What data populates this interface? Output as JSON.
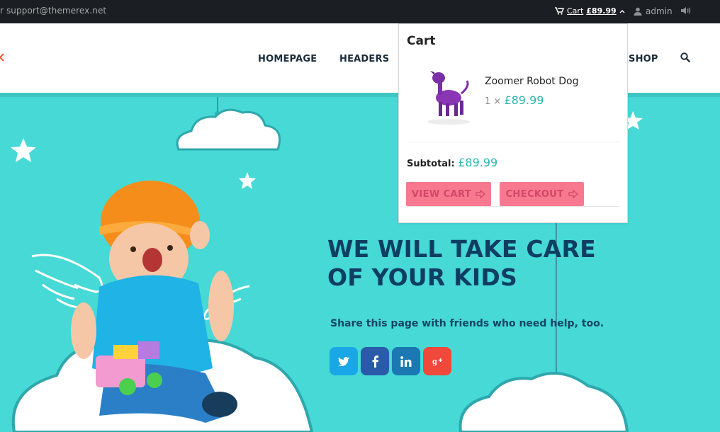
{
  "topbar": {
    "email": "r support@themerex.net",
    "cart_label": "Cart",
    "cart_amount": "£89.99",
    "user": "admin"
  },
  "nav": {
    "items": [
      "HOMEPAGE",
      "HEADERS",
      "SHOP"
    ]
  },
  "cart": {
    "title": "Cart",
    "product_name": "Zoomer Robot Dog",
    "qty": "1 ×",
    "price": "£89.99",
    "subtotal_label": "Subtotal:",
    "subtotal_value": "£89.99",
    "view_cart": "VIEW CART",
    "checkout": "CHECKOUT"
  },
  "hero": {
    "headline_1": "WE WILL TAKE CARE",
    "headline_2": "OF YOUR KIDS",
    "share": "Share this page with friends who need help, too."
  },
  "social": {
    "twitter_color": "#1aa7e8",
    "facebook_color": "#2a5ba8",
    "linkedin_color": "#1b78b3",
    "google_color": "#f0483a"
  },
  "icons": [
    "cart-icon",
    "chevron-up-icon",
    "user-icon",
    "speaker-icon",
    "search-icon",
    "arrow-right-icon",
    "twitter-icon",
    "facebook-icon",
    "linkedin-icon",
    "google-plus-icon"
  ]
}
